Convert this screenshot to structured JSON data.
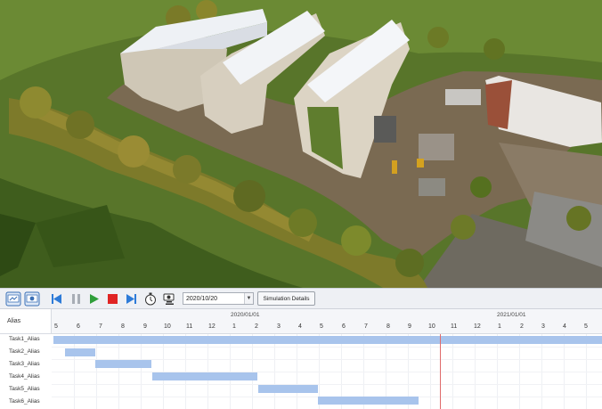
{
  "toolbar": {
    "date_value": "2020/10/20",
    "sim_details_label": "Simulation Details"
  },
  "gantt": {
    "header_label": "Alias",
    "years": [
      "2020/01/01",
      "2021/01/01"
    ],
    "months": [
      "5",
      "6",
      "7",
      "8",
      "9",
      "10",
      "11",
      "12",
      "1",
      "2",
      "3",
      "4",
      "5",
      "6",
      "7",
      "8",
      "9",
      "10",
      "11",
      "12",
      "1",
      "2",
      "3",
      "4",
      "5"
    ],
    "tasks": [
      {
        "name": "Task1_Alias"
      },
      {
        "name": "Task2_Alias"
      },
      {
        "name": "Task3_Alias"
      },
      {
        "name": "Task4_Alias"
      },
      {
        "name": "Task5_Alias"
      },
      {
        "name": "Task6_Alias"
      }
    ]
  }
}
